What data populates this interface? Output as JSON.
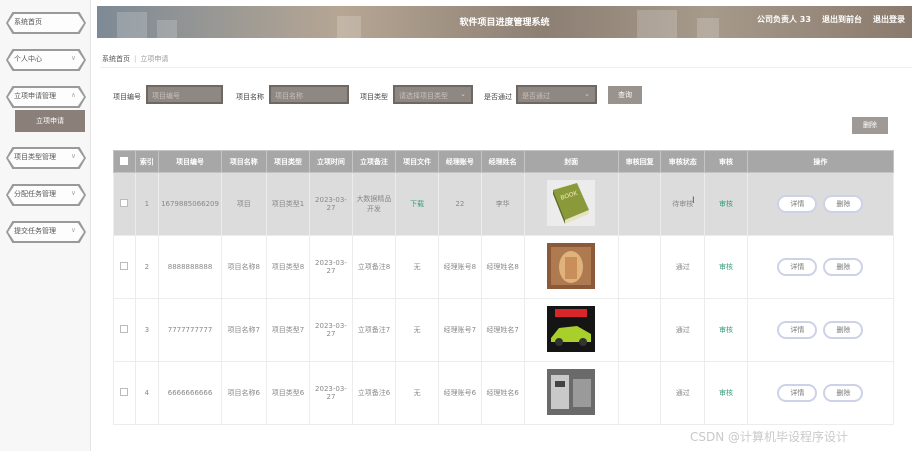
{
  "sidebar": {
    "items": [
      {
        "label": "系统首页",
        "chev": ""
      },
      {
        "label": "个人中心",
        "chev": "∨"
      },
      {
        "label": "立项申请管理",
        "chev": "∧"
      },
      {
        "label": "项目类型管理",
        "chev": "∨"
      },
      {
        "label": "分配任务管理",
        "chev": "∨"
      },
      {
        "label": "提交任务管理",
        "chev": "∨"
      }
    ],
    "sub_item": "立项申请"
  },
  "header": {
    "title": "软件项目进度管理系统",
    "user": "公司负责人 33",
    "back": "退出到前台",
    "logout": "退出登录"
  },
  "breadcrumb": {
    "home": "系统首页",
    "current": "立项申请"
  },
  "search": {
    "fields": [
      {
        "label": "项目编号",
        "placeholder": "项目编号"
      },
      {
        "label": "项目名称",
        "placeholder": "项目名称"
      },
      {
        "label": "项目类型",
        "placeholder": "请选择项目类型"
      },
      {
        "label": "是否通过",
        "placeholder": "是否通过"
      }
    ],
    "button": "查询"
  },
  "delete_button": "删除",
  "table": {
    "headers": [
      "",
      "索引",
      "项目编号",
      "项目名称",
      "项目类型",
      "立项时间",
      "立项备注",
      "项目文件",
      "经理账号",
      "经理姓名",
      "封面",
      "审核回复",
      "审核状态",
      "审核",
      "操作"
    ],
    "rows": [
      {
        "index": "1",
        "code": "1679885066209",
        "name": "项目",
        "type": "项目类型1",
        "date": "2023-03-27",
        "note": "大数据精品开发",
        "file": "下载",
        "acct": "22",
        "mgr": "李华",
        "reply": "",
        "status": "待审核",
        "audit": "审核",
        "detail": "详情",
        "del": "删除"
      },
      {
        "index": "2",
        "code": "8888888888",
        "name": "项目名称8",
        "type": "项目类型8",
        "date": "2023-03-27",
        "note": "立项备注8",
        "file": "无",
        "acct": "经理账号8",
        "mgr": "经理姓名8",
        "reply": "",
        "status": "通过",
        "audit": "审核",
        "detail": "详情",
        "del": "删除"
      },
      {
        "index": "3",
        "code": "7777777777",
        "name": "项目名称7",
        "type": "项目类型7",
        "date": "2023-03-27",
        "note": "立项备注7",
        "file": "无",
        "acct": "经理账号7",
        "mgr": "经理姓名7",
        "reply": "",
        "status": "通过",
        "audit": "审核",
        "detail": "详情",
        "del": "删除"
      },
      {
        "index": "4",
        "code": "6666666666",
        "name": "项目名称6",
        "type": "项目类型6",
        "date": "2023-03-27",
        "note": "立项备注6",
        "file": "无",
        "acct": "经理账号6",
        "mgr": "经理姓名6",
        "reply": "",
        "status": "通过",
        "audit": "审核",
        "detail": "详情",
        "del": "删除"
      }
    ]
  },
  "watermark": "CSDN @计算机毕设程序设计"
}
